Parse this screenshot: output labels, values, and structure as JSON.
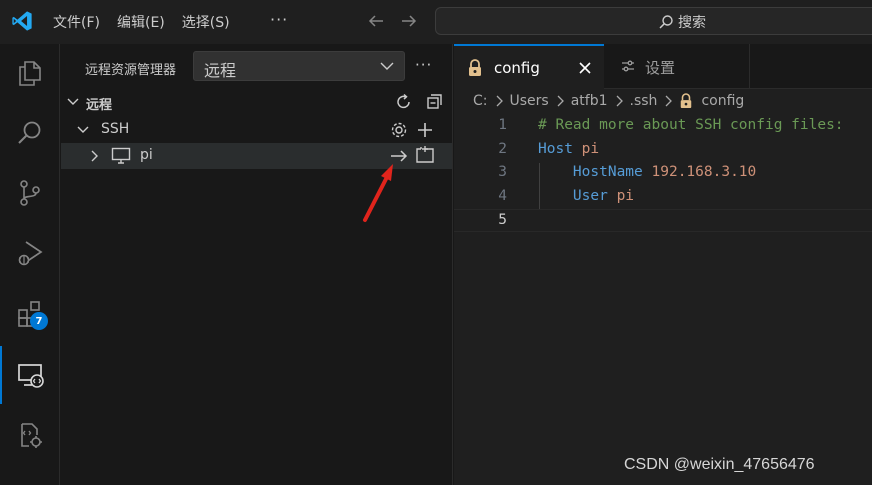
{
  "titlebar": {
    "menus": [
      "文件(F)",
      "编辑(E)",
      "选择(S)"
    ],
    "more": "···",
    "search": {
      "label": "搜索"
    }
  },
  "activity": {
    "extensions_badge": "7",
    "accent_color": "#0078d4"
  },
  "sidebar": {
    "title": "远程资源管理器",
    "select_value": "远程",
    "more": "···",
    "section": "远程",
    "ssh_label": "SSH",
    "host_label": "pi"
  },
  "editor": {
    "tabs": [
      {
        "label": "config",
        "active": true
      },
      {
        "label": "设置",
        "active": false
      }
    ],
    "breadcrumb": [
      "C:",
      "Users",
      "atfb1",
      ".ssh",
      "config"
    ],
    "lines": [
      {
        "n": "1",
        "parts": [
          {
            "t": "# Read more about SSH config files:",
            "c": "#6a9955"
          }
        ]
      },
      {
        "n": "2",
        "parts": [
          {
            "t": "Host ",
            "c": "#569cd6"
          },
          {
            "t": "pi",
            "c": "#ce9178"
          }
        ]
      },
      {
        "n": "3",
        "parts": [
          {
            "t": "    ",
            "c": "#cccccc"
          },
          {
            "t": "HostName ",
            "c": "#569cd6"
          },
          {
            "t": "192.168.3.10",
            "c": "#ce9178"
          }
        ]
      },
      {
        "n": "4",
        "parts": [
          {
            "t": "    ",
            "c": "#cccccc"
          },
          {
            "t": "User ",
            "c": "#569cd6"
          },
          {
            "t": "pi",
            "c": "#ce9178"
          }
        ]
      },
      {
        "n": "5",
        "parts": []
      }
    ],
    "current_line": "5"
  },
  "watermark": "CSDN @weixin_47656476"
}
